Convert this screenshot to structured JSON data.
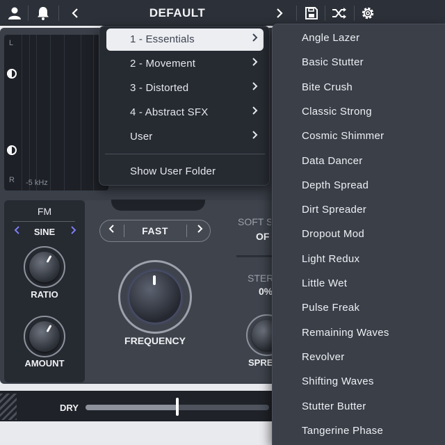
{
  "header": {
    "preset_name": "DEFAULT",
    "icons": [
      "user-icon",
      "bell-icon",
      "chevron-left-icon",
      "chevron-right-icon",
      "save-icon",
      "shuffle-icon",
      "gear-icon"
    ]
  },
  "analyzer": {
    "channel_left": "L",
    "channel_right": "R",
    "freq_label": "-5 kHz"
  },
  "category_menu": {
    "items": [
      {
        "label": "1 - Essentials",
        "active": true
      },
      {
        "label": "2 - Movement"
      },
      {
        "label": "3 - Distorted"
      },
      {
        "label": "4 - Abstract SFX"
      },
      {
        "label": "User"
      }
    ],
    "show_folder": "Show User Folder"
  },
  "preset_menu": {
    "items": [
      "Angle Lazer",
      "Basic Stutter",
      "Bite Crush",
      "Classic Strong",
      "Cosmic Shimmer",
      "Data Dancer",
      "Depth Spread",
      "Dirt Spreader",
      "Dropout Mod",
      "Light Redux",
      "Little Wet",
      "Pulse Freak",
      "Remaining Waves",
      "Revolver",
      "Shifting Waves",
      "Stutter Butter",
      "Tangerine Phase"
    ]
  },
  "fm": {
    "title": "FM",
    "waveform": "SINE",
    "ratio_label": "RATIO",
    "amount_label": "AMOUNT"
  },
  "modulation": {
    "speed": "FAST",
    "frequency_label": "FREQUENCY",
    "soft_label": "SOFT S",
    "soft_value": "OF",
    "stereo_label": "STER",
    "stereo_value": "0%",
    "spread_label": "SPRE"
  },
  "mix": {
    "dry_label": "DRY",
    "dry_wet_fraction": 0.5
  },
  "colors": {
    "accent": "#7d7ff3",
    "menu_bg": "#262a31",
    "submenu_bg": "#3a3f48",
    "active_item_bg": "#eceef2"
  }
}
